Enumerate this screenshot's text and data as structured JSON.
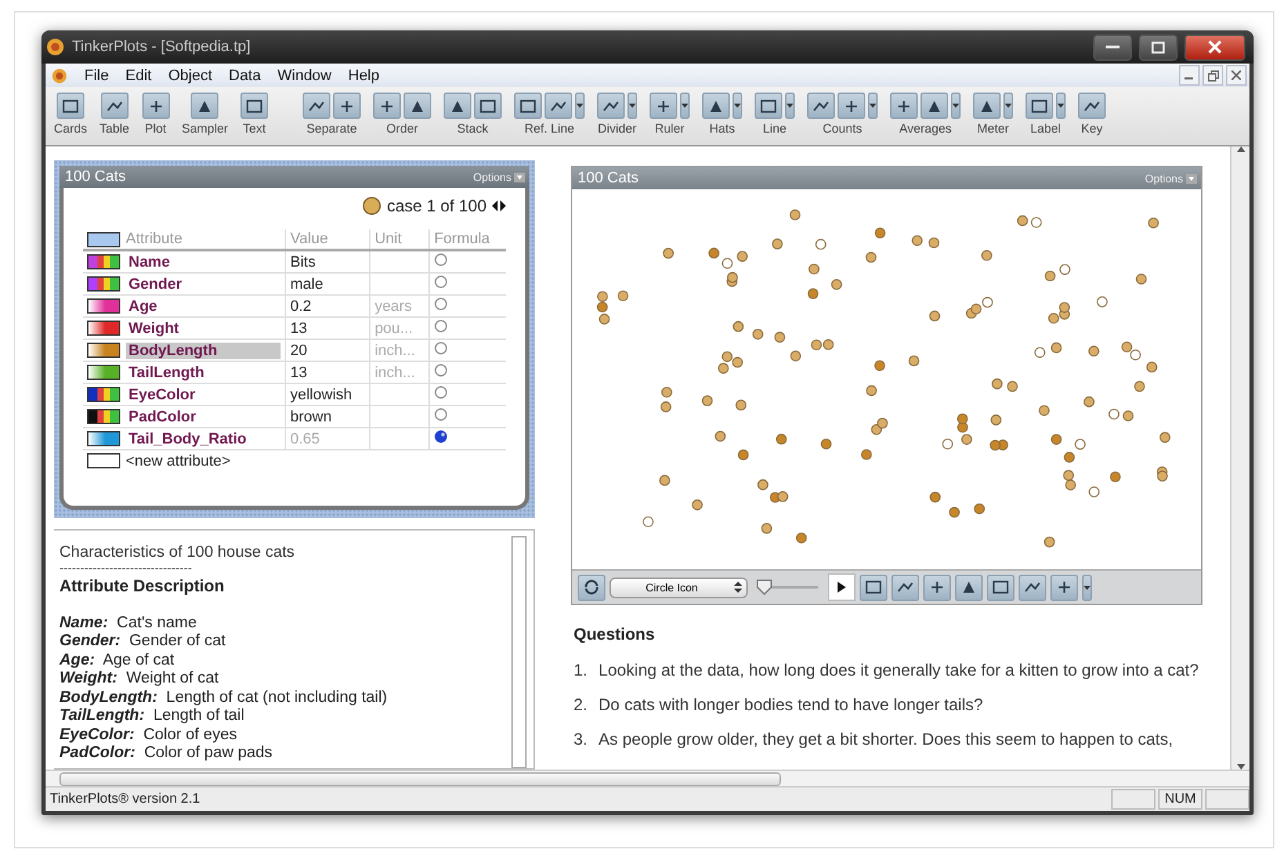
{
  "window": {
    "title": "TinkerPlots - [Softpedia.tp]"
  },
  "menu": [
    "File",
    "Edit",
    "Object",
    "Data",
    "Window",
    "Help"
  ],
  "toolbar": [
    {
      "label": "Cards",
      "kind": "single"
    },
    {
      "label": "Table",
      "kind": "single"
    },
    {
      "label": "Plot",
      "kind": "single"
    },
    {
      "label": "Sampler",
      "kind": "single"
    },
    {
      "label": "Text",
      "kind": "single"
    },
    {
      "label": "Separate",
      "kind": "pair"
    },
    {
      "label": "Order",
      "kind": "pair"
    },
    {
      "label": "Stack",
      "kind": "pair"
    },
    {
      "label": "Ref. Line",
      "kind": "pair-menu"
    },
    {
      "label": "Divider",
      "kind": "single-menu"
    },
    {
      "label": "Ruler",
      "kind": "single-menu"
    },
    {
      "label": "Hats",
      "kind": "single-menu"
    },
    {
      "label": "Line",
      "kind": "single-menu"
    },
    {
      "label": "Counts",
      "kind": "pair-menu"
    },
    {
      "label": "Averages",
      "kind": "pair-menu"
    },
    {
      "label": "Meter",
      "kind": "single-menu"
    },
    {
      "label": "Label",
      "kind": "single-menu"
    },
    {
      "label": "Key",
      "kind": "single"
    }
  ],
  "case_card": {
    "title": "100 Cats",
    "options": "Options",
    "case_label": "case 1 of 100",
    "columns": [
      "Attribute",
      "Value",
      "Unit",
      "Formula"
    ],
    "attributes": [
      {
        "name": "Name",
        "value": "Bits",
        "kind": "categorical",
        "color": "#c040e0",
        "formula": false,
        "selected": false
      },
      {
        "name": "Gender",
        "value": "male",
        "kind": "categorical",
        "color": "#b040ff",
        "formula": false,
        "selected": false
      },
      {
        "name": "Age",
        "value": "0.2",
        "unit": "years",
        "kind": "numeric",
        "color": "#e0309a",
        "formula": false,
        "selected": false
      },
      {
        "name": "Weight",
        "value": "13",
        "unit": "pou...",
        "kind": "numeric",
        "color": "#e02828",
        "formula": false,
        "selected": false
      },
      {
        "name": "BodyLength",
        "value": "20",
        "unit": "inch...",
        "kind": "numeric",
        "color": "#c8821e",
        "formula": false,
        "selected": true
      },
      {
        "name": "TailLength",
        "value": "13",
        "unit": "inch...",
        "kind": "numeric",
        "color": "#58b028",
        "formula": false,
        "selected": false
      },
      {
        "name": "EyeColor",
        "value": "yellowish",
        "kind": "categorical",
        "color": "#1030c0",
        "formula": false,
        "selected": false
      },
      {
        "name": "PadColor",
        "value": "brown",
        "kind": "categorical",
        "color": "#101010",
        "formula": false,
        "selected": false
      },
      {
        "name": "Tail_Body_Ratio",
        "value": "0.65",
        "kind": "numeric",
        "color": "#2098d8",
        "formula": true,
        "selected": false
      }
    ],
    "new_attribute": "<new attribute>"
  },
  "description": {
    "title": "Characteristics of 100 house cats",
    "rule": "--------------------------------",
    "heading": "Attribute Description",
    "items": [
      {
        "term": "Name:",
        "text": "Cat's name"
      },
      {
        "term": "Gender:",
        "text": "Gender of cat"
      },
      {
        "term": "Age:",
        "text": "Age of cat"
      },
      {
        "term": "Weight:",
        "text": "Weight of cat"
      },
      {
        "term": "BodyLength:",
        "text": "Length of cat (not including tail)"
      },
      {
        "term": "TailLength:",
        "text": "Length of tail"
      },
      {
        "term": "EyeColor:",
        "text": "Color of eyes"
      },
      {
        "term": "PadColor:",
        "text": "Color of paw pads"
      }
    ]
  },
  "plot": {
    "title": "100 Cats",
    "options": "Options",
    "icon_menu": "Circle Icon",
    "icon_size": {
      "level": 0.12
    }
  },
  "questions": {
    "heading": "Questions",
    "items": [
      {
        "number": "1.",
        "text": "Looking at the data, how long does it generally take for a kitten to grow into a cat?"
      },
      {
        "number": "2.",
        "text": "Do cats with longer bodies tend to have longer tails?"
      },
      {
        "number": "3.",
        "text": "As people grow older, they get a bit shorter. Does this seem to happen to cats,"
      }
    ]
  },
  "status_bar": {
    "text": "TinkerPlots® version 2.1",
    "indicators": [
      "NUM"
    ]
  }
}
